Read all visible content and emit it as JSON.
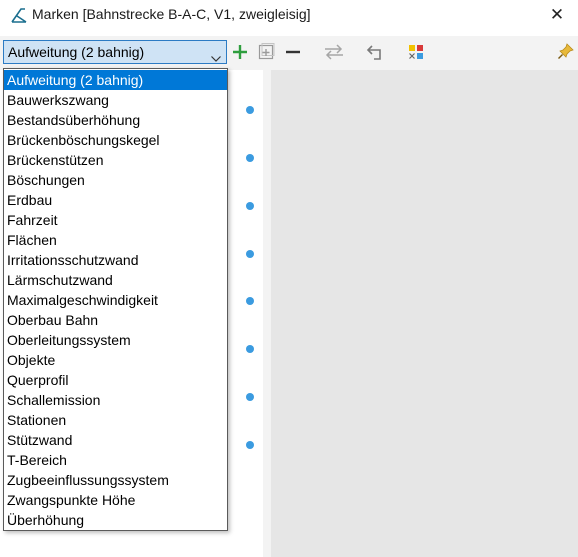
{
  "window": {
    "title": "Marken [Bahnstrecke B-A-C, V1, zweigleisig]",
    "close_label": "✕"
  },
  "toolbar": {
    "combo_value": "Aufweitung (2 bahnig)",
    "buttons": [
      "add-icon",
      "add-box-icon",
      "remove-icon",
      "swap-icon",
      "undo-icon",
      "color-grid-icon",
      "pin-icon"
    ],
    "accent_add": "#2e9e3e",
    "pin_color": "#e8b93a"
  },
  "dropdown": {
    "items": [
      "Aufweitung (2 bahnig)",
      "Bauwerkszwang",
      "Bestandsüberhöhung",
      "Brückenböschungskegel",
      "Brückenstützen",
      "Böschungen",
      "Erdbau",
      "Fahrzeit",
      "Flächen",
      "Irritationsschutzwand",
      "Lärmschutzwand",
      "Maximalgeschwindigkeit",
      "Oberbau Bahn",
      "Oberleitungssystem",
      "Objekte",
      "Querprofil",
      "Schallemission",
      "Stationen",
      "Stützwand",
      "T-Bereich",
      "Zugbeeinflussungssystem",
      "Zwangspunkte Höhe",
      "Überhöhung"
    ],
    "selected_index": 0
  },
  "colors": {
    "selection": "#0078d7",
    "combo_bg": "#cfe3f5",
    "dot": "#3b9be0",
    "workspace": "#e6e6e6"
  }
}
